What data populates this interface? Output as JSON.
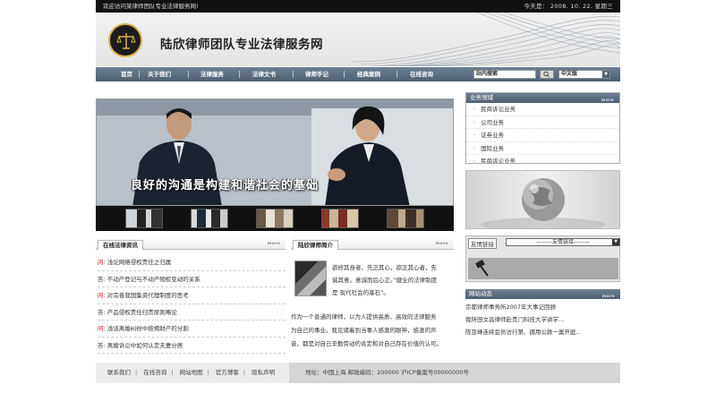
{
  "topbar": {
    "welcome": "欢迎访问某律师团队专业法律服务网!",
    "date": "今天是： 2008. 10. 22.  星期三"
  },
  "header": {
    "title": "陆欣律师团队专业法律服务网",
    "logo_icon": "scales-of-justice-icon"
  },
  "nav": {
    "items": [
      "首页",
      "关于我们",
      "法律服务",
      "法律文书",
      "律师手记",
      "经典案例",
      "在线咨询"
    ],
    "search_value": "站内搜索",
    "search_icon": "search-icon",
    "select_value": "中文版"
  },
  "banner": {
    "slogan": "良好的沟通是构建和谐社会的基础"
  },
  "news": {
    "title": "在线法律资讯",
    "more": "more",
    "items": [
      {
        "prefix": "问:",
        "text": "浅论网络侵权责任之归属"
      },
      {
        "prefix": "答:",
        "text": "不动产登记与不动产物权变动的关系"
      },
      {
        "prefix": "问:",
        "text": "对完善我国集资代理制度的思考"
      },
      {
        "prefix": "答:",
        "text": "产品侵权责任归责原则略论"
      },
      {
        "prefix": "问:",
        "text": "浅谈离婚纠纷中按揭财产的分割"
      },
      {
        "prefix": "答:",
        "text": "离婚诉讼中如何认定夫妻分居"
      }
    ]
  },
  "lawyer": {
    "title": "陆欣律师简介",
    "more": "more",
    "line1": "欲修其身者，先正其心，欲正其心者，先",
    "line2": "诚其意。意诚而后心正。”健全的法律制度",
    "line3": "是 现代社会的基石”。",
    "para1": "作为一个普通的律师，以为人提供高质、高效的法律服务",
    "para2": "为自己的事业。我见诸着到当事人感激的眼神，感激的声",
    "para3": "音，都是对自己辛勤劳动的肯定和对自己存在价值的认可。"
  },
  "practice": {
    "title": "业务领域",
    "more": "more",
    "items": [
      "民商诉讼业务",
      "公司业务",
      "证券业务",
      "国际业务",
      "民商诉讼业务"
    ]
  },
  "friendlinks": {
    "label": "友情链接",
    "select_value": "———友情链接———"
  },
  "webnews": {
    "title": "网站动态",
    "more": "more",
    "items": [
      "京都律师事务所2007年大事记回顾",
      "我所田文昌律师赴贵门科技大学讲学…",
      "陈亚峰连续会员访行第、挪用公款一案开庭…"
    ]
  },
  "footer": {
    "links": [
      "联系我们",
      "在线咨询",
      "网站地图",
      "官方博客",
      "隐私声明"
    ],
    "address": "地址：中国上海  邮政编码：200000    沪ICP备案号00000000号"
  },
  "colors": {
    "nav_bg": "#5a6b7f",
    "topbar_bg": "#111111",
    "accent_red": "#cc0000"
  }
}
